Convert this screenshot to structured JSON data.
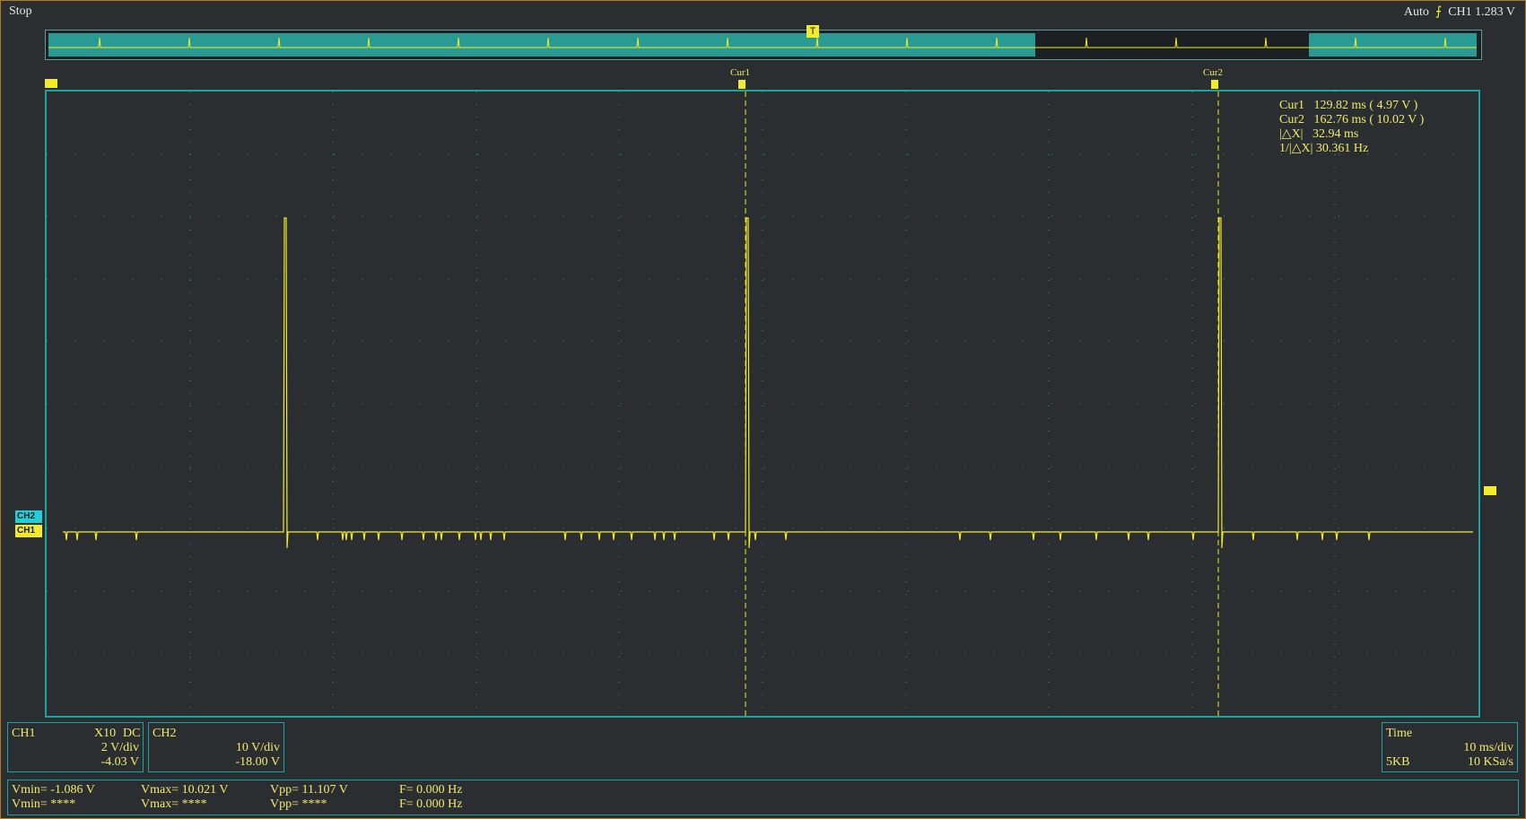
{
  "status": "Stop",
  "trigger": {
    "mode": "Auto",
    "slope_icon": "rising-edge-icon",
    "source": "CH1",
    "level": "1.283 V"
  },
  "trigger_marker": "T",
  "channels": {
    "ch1_label": "CH1",
    "ch2_label": "CH2"
  },
  "cursors": {
    "cur1_label": "Cur1",
    "cur2_label": "Cur2",
    "readout": [
      "Cur1   129.82 ms ( 4.97 V )",
      "Cur2   162.76 ms ( 10.02 V )",
      "|△X|   32.94 ms",
      "1/|△X| 30.361 Hz"
    ]
  },
  "ch1_panel": {
    "name": "CH1",
    "probe": "X10",
    "coupling": "DC",
    "scale": "2 V/div",
    "offset": "-4.03 V"
  },
  "ch2_panel": {
    "name": "CH2",
    "scale": "10 V/div",
    "offset": "-18.00 V"
  },
  "time_panel": {
    "title": "Time",
    "scale": "10 ms/div",
    "memory": "5KB",
    "sample_rate": "10 KSa/s"
  },
  "measurements": {
    "ch1": {
      "vmin": "Vmin= -1.086 V",
      "vmax": "Vmax= 10.021 V",
      "vpp": "Vpp= 11.107 V",
      "freq": "F= 0.000 Hz"
    },
    "ch2": {
      "vmin": "Vmin= ****",
      "vmax": "Vmax= ****",
      "vpp": "Vpp= ****",
      "freq": "F= 0.000 Hz"
    }
  },
  "colors": {
    "ch1": "#f2ea2a",
    "ch2": "#22cfd8",
    "grid_border": "#1aa3a0",
    "background": "#2b2e30"
  },
  "icons": [
    "rising-edge-icon",
    "trigger-t-icon",
    "cursor-marker-icon",
    "left-position-icon",
    "right-level-icon"
  ]
}
